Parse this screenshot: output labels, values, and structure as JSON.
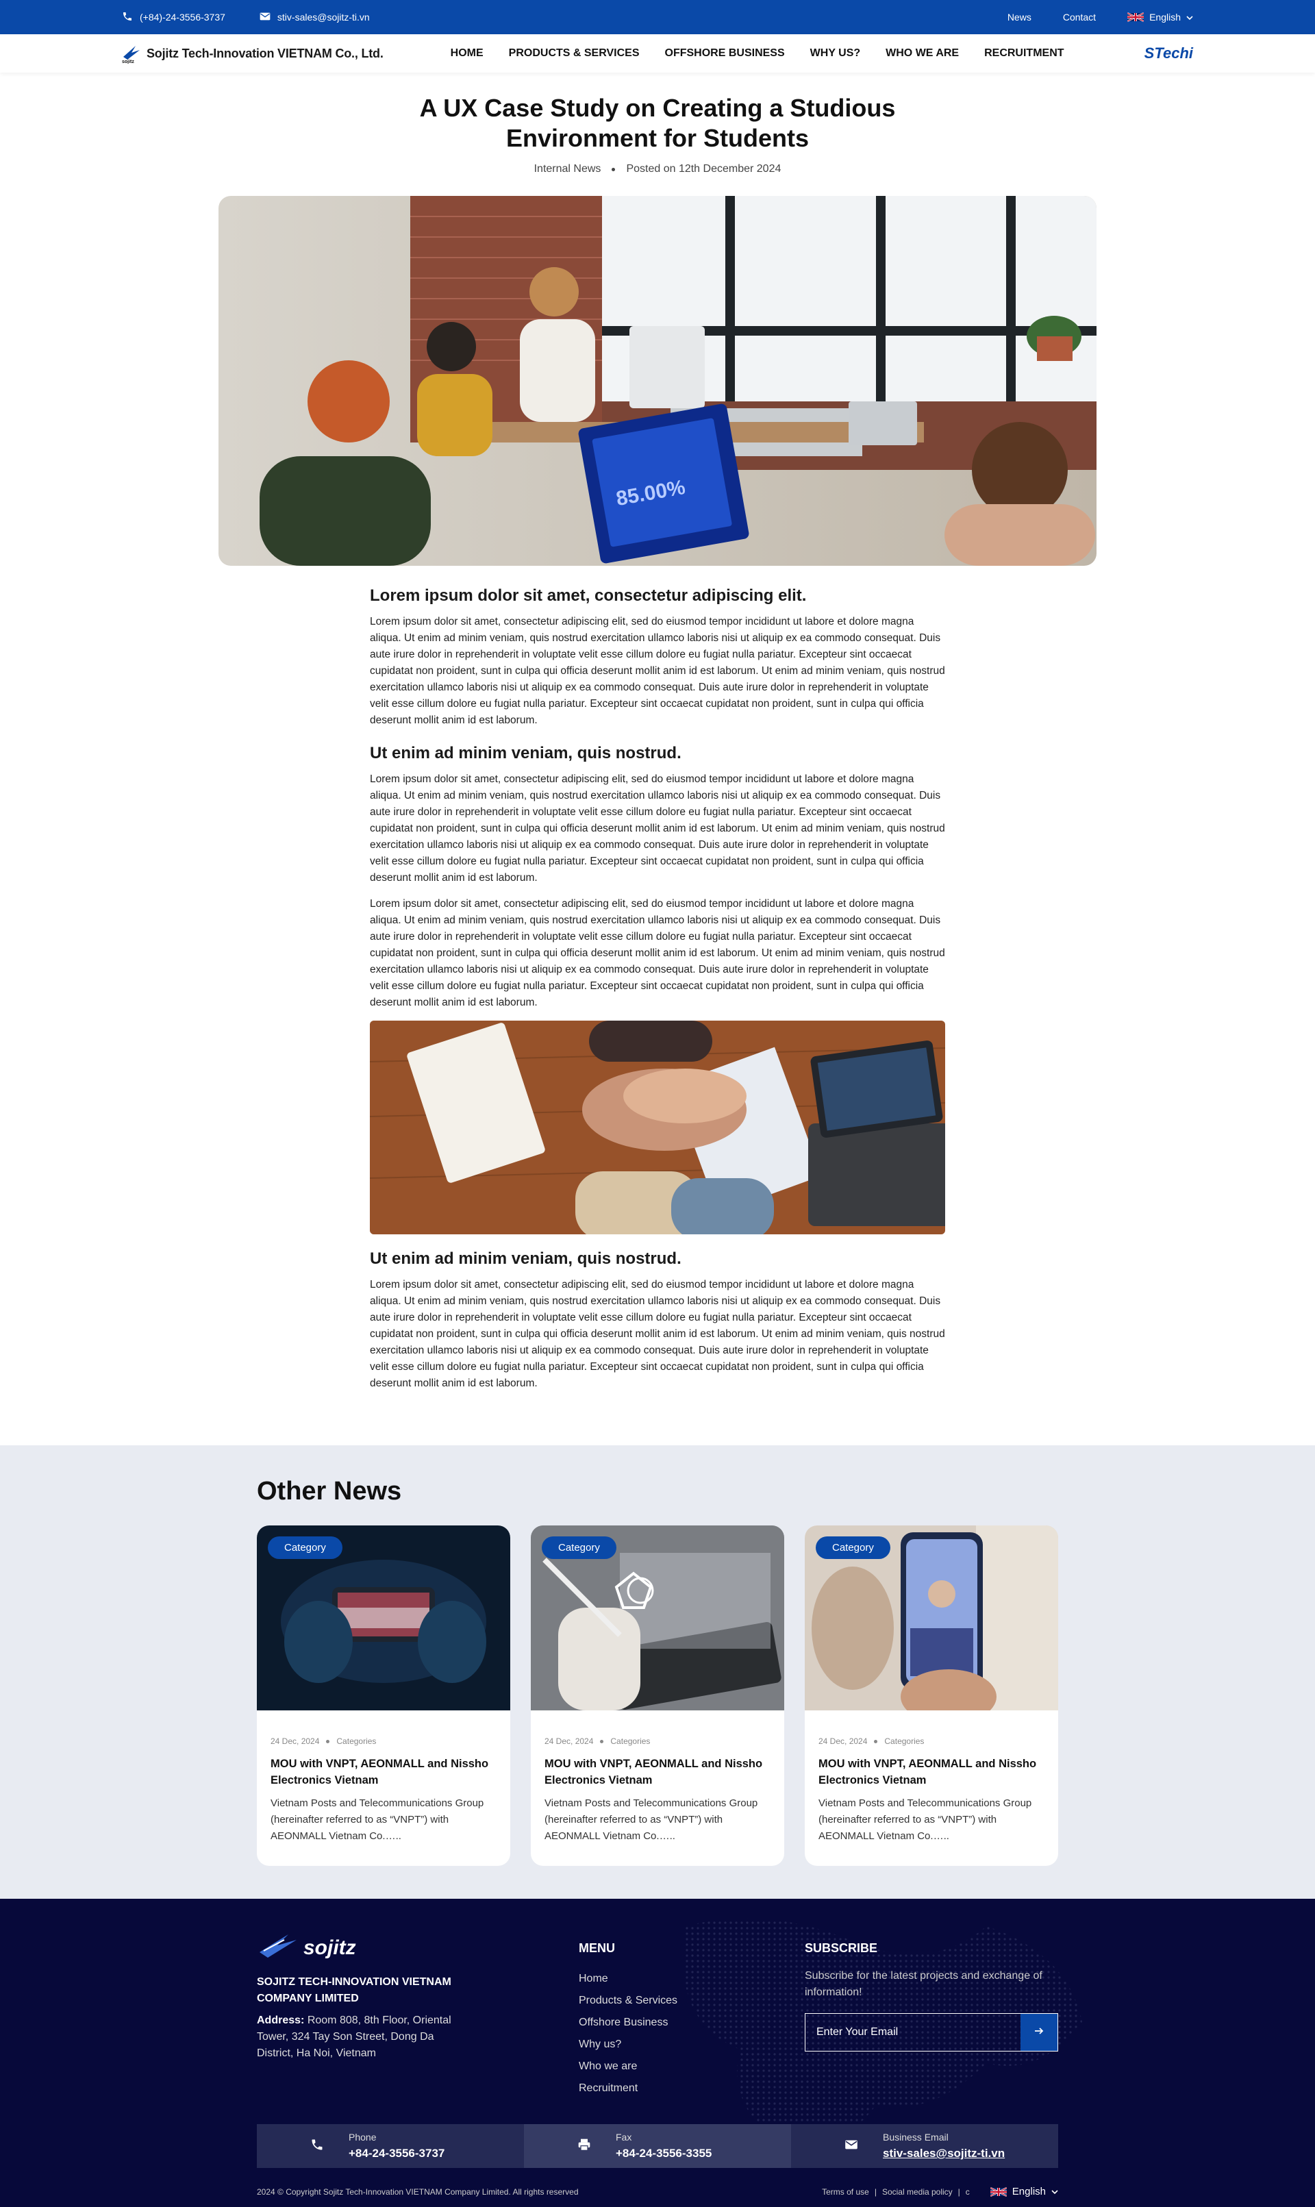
{
  "topbar": {
    "phone": "(+84)-24-3556-3737",
    "email": "stiv-sales@sojitz-ti.vn",
    "links": [
      "News",
      "Contact"
    ],
    "language": "English"
  },
  "nav": {
    "logo_text": "Sojitz Tech-Innovation VIETNAM Co., Ltd.",
    "logo_sub": "sojitz",
    "menu": [
      "HOME",
      "PRODUCTS & SERVICES",
      "OFFSHORE BUSINESS",
      "WHY US?",
      "WHO WE ARE",
      "RECRUITMENT"
    ],
    "brand_right": "STechi"
  },
  "article": {
    "title": "A UX Case Study on Creating a Studious Environment for Students",
    "category": "Internal News",
    "posted": "Posted on 12th December 2024",
    "hero_screen_text": "85.00%",
    "sections": [
      {
        "heading": "Lorem ipsum dolor sit amet, consectetur adipiscing elit.",
        "paragraphs": [
          "Lorem ipsum dolor sit amet, consectetur adipiscing elit, sed do eiusmod tempor incididunt ut labore et dolore magna aliqua. Ut enim ad minim veniam, quis nostrud exercitation ullamco laboris nisi ut aliquip ex ea commodo consequat. Duis aute irure dolor in reprehenderit in voluptate velit esse cillum dolore eu fugiat nulla pariatur. Excepteur sint occaecat cupidatat non proident, sunt in culpa qui officia deserunt mollit anim id est laborum. Ut enim ad minim veniam, quis nostrud exercitation ullamco laboris nisi ut aliquip ex ea commodo consequat. Duis aute irure dolor in reprehenderit in voluptate velit esse cillum dolore eu fugiat nulla pariatur. Excepteur sint occaecat cupidatat non proident, sunt in culpa qui officia deserunt mollit anim id est laborum."
        ]
      },
      {
        "heading": "Ut enim ad minim veniam, quis nostrud.",
        "paragraphs": [
          "Lorem ipsum dolor sit amet, consectetur adipiscing elit, sed do eiusmod tempor incididunt ut labore et dolore magna aliqua. Ut enim ad minim veniam, quis nostrud exercitation ullamco laboris nisi ut aliquip ex ea commodo consequat. Duis aute irure dolor in reprehenderit in voluptate velit esse cillum dolore eu fugiat nulla pariatur. Excepteur sint occaecat cupidatat non proident, sunt in culpa qui officia deserunt mollit anim id est laborum. Ut enim ad minim veniam, quis nostrud exercitation ullamco laboris nisi ut aliquip ex ea commodo consequat. Duis aute irure dolor in reprehenderit in voluptate velit esse cillum dolore eu fugiat nulla pariatur. Excepteur sint occaecat cupidatat non proident, sunt in culpa qui officia deserunt mollit anim id est laborum.",
          "Lorem ipsum dolor sit amet, consectetur adipiscing elit, sed do eiusmod tempor incididunt ut labore et dolore magna aliqua. Ut enim ad minim veniam, quis nostrud exercitation ullamco laboris nisi ut aliquip ex ea commodo consequat. Duis aute irure dolor in reprehenderit in voluptate velit esse cillum dolore eu fugiat nulla pariatur. Excepteur sint occaecat cupidatat non proident, sunt in culpa qui officia deserunt mollit anim id est laborum. Ut enim ad minim veniam, quis nostrud exercitation ullamco laboris nisi ut aliquip ex ea commodo consequat. Duis aute irure dolor in reprehenderit in voluptate velit esse cillum dolore eu fugiat nulla pariatur. Excepteur sint occaecat cupidatat non proident, sunt in culpa qui officia deserunt mollit anim id est laborum."
        ]
      },
      {
        "heading": "Ut enim ad minim veniam, quis nostrud.",
        "paragraphs": [
          "Lorem ipsum dolor sit amet, consectetur adipiscing elit, sed do eiusmod tempor incididunt ut labore et dolore magna aliqua. Ut enim ad minim veniam, quis nostrud exercitation ullamco laboris nisi ut aliquip ex ea commodo consequat. Duis aute irure dolor in reprehenderit in voluptate velit esse cillum dolore eu fugiat nulla pariatur. Excepteur sint occaecat cupidatat non proident, sunt in culpa qui officia deserunt mollit anim id est laborum. Ut enim ad minim veniam, quis nostrud exercitation ullamco laboris nisi ut aliquip ex ea commodo consequat. Duis aute irure dolor in reprehenderit in voluptate velit esse cillum dolore eu fugiat nulla pariatur. Excepteur sint occaecat cupidatat non proident, sunt in culpa qui officia deserunt mollit anim id est laborum."
        ]
      }
    ]
  },
  "other_news": {
    "heading": "Other News",
    "cards": [
      {
        "badge": "Category",
        "date": "24 Dec, 2024",
        "category": "Categories",
        "title": "MOU with VNPT, AEONMALL and Nissho Electronics Vietnam",
        "desc": "Vietnam Posts and Telecommunications Group (hereinafter referred to as “VNPT”) with AEONMALL Vietnam Co.….."
      },
      {
        "badge": "Category",
        "date": "24 Dec, 2024",
        "category": "Categories",
        "title": "MOU with VNPT, AEONMALL and Nissho Electronics Vietnam",
        "desc": "Vietnam Posts and Telecommunications Group (hereinafter referred to as “VNPT”) with AEONMALL Vietnam Co.….."
      },
      {
        "badge": "Category",
        "date": "24 Dec, 2024",
        "category": "Categories",
        "title": "MOU with VNPT, AEONMALL and Nissho Electronics Vietnam",
        "desc": "Vietnam Posts and Telecommunications Group (hereinafter referred to as “VNPT”) with AEONMALL Vietnam Co.….."
      }
    ]
  },
  "footer": {
    "logo_text": "sojitz",
    "company": "SOJITZ TECH-INNOVATION VIETNAM COMPANY LIMITED",
    "address_label": "Address:",
    "address": "Room 808, 8th Floor, Oriental Tower, 324 Tay Son Street, Dong Da District, Ha Noi, Vietnam",
    "menu_heading": "MENU",
    "menu": [
      "Home",
      "Products & Services",
      "Offshore Business",
      "Why us?",
      "Who we are",
      "Recruitment"
    ],
    "subscribe_heading": "SUBSCRIBE",
    "subscribe_text": "Subscribe for the latest projects and exchange of information!",
    "email_placeholder": "Enter Your Email",
    "phone_label": "Phone",
    "phone": "+84-24-3556-3737",
    "fax_label": "Fax",
    "fax": "+84-24-3556-3355",
    "bemail_label": "Business Email",
    "bemail": "stiv-sales@sojitz-ti.vn",
    "copyright": "2024 © Copyright Sojitz Tech-Innovation VIETNAM Company Limited. All rights reserved",
    "terms": "Terms of use",
    "social": "Social media policy",
    "extra": "c",
    "language": "English"
  },
  "colors": {
    "brand": "#0a49a8",
    "footer_bg": "#07093a",
    "section_bg": "#e8ebf2"
  }
}
